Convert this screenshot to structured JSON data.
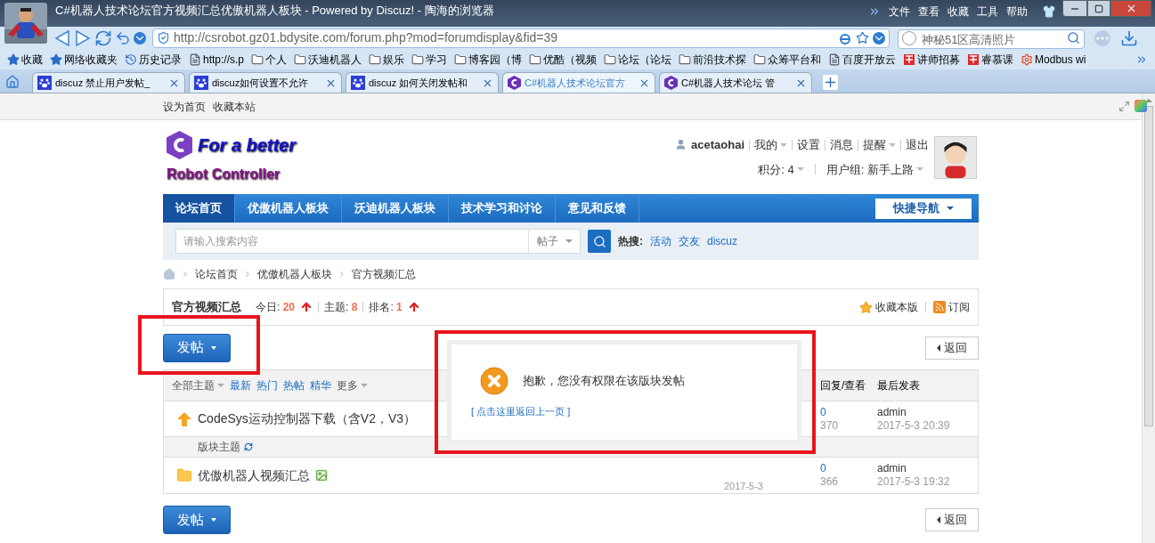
{
  "browser": {
    "title": "C#机器人技术论坛官方视频汇总优傲机器人板块 - Powered by Discuz! - 陶海的浏览器",
    "menu": [
      "文件",
      "查看",
      "收藏",
      "工具",
      "帮助"
    ],
    "address": "http://csrobot.gz01.bdysite.com/forum.php?mod=forumdisplay&fid=39",
    "search_placeholder": "神秘51区高清照片",
    "bookmarks": [
      {
        "label": "收藏",
        "kind": "fav"
      },
      {
        "label": "网络收藏夹",
        "kind": "star"
      },
      {
        "label": "历史记录",
        "kind": "history"
      },
      {
        "label": "http://s.p",
        "kind": "page"
      },
      {
        "label": "个人",
        "kind": "folder"
      },
      {
        "label": "沃迪机器人",
        "kind": "folder"
      },
      {
        "label": "娱乐",
        "kind": "folder"
      },
      {
        "label": "学习",
        "kind": "folder"
      },
      {
        "label": "博客园（博",
        "kind": "folder"
      },
      {
        "label": "优酷（视频",
        "kind": "folder"
      },
      {
        "label": "论坛（论坛",
        "kind": "folder"
      },
      {
        "label": "前沿技术探",
        "kind": "folder"
      },
      {
        "label": "众筹平台和",
        "kind": "folder"
      },
      {
        "label": "百度开放云",
        "kind": "page"
      },
      {
        "label": "讲师招募",
        "kind": "seal"
      },
      {
        "label": "睿慕课",
        "kind": "seal"
      },
      {
        "label": "Modbus wi",
        "kind": "gear"
      }
    ],
    "tabs": [
      {
        "label": "discuz 禁止用户发帖_",
        "kind": "paw",
        "selected": false
      },
      {
        "label": "discuz如何设置不允许",
        "kind": "paw",
        "selected": false
      },
      {
        "label": "discuz 如何关闭发帖和",
        "kind": "paw",
        "selected": false
      },
      {
        "label": "C#机器人技术论坛官方",
        "kind": "hex",
        "selected": true
      },
      {
        "label": "C#机器人技术论坛 管",
        "kind": "hex",
        "selected": false
      }
    ]
  },
  "site": {
    "top_links": [
      "设为首页",
      "收藏本站"
    ],
    "logo": {
      "line1": "For a better",
      "line2": "Robot Controller"
    },
    "user": {
      "name": "acetaohai",
      "links": [
        {
          "label": "我的",
          "dropdown": true
        },
        {
          "label": "设置",
          "dropdown": false
        },
        {
          "label": "消息",
          "dropdown": false
        },
        {
          "label": "提醒",
          "dropdown": true
        },
        {
          "label": "退出",
          "dropdown": false
        }
      ],
      "credits": "积分: 4",
      "group": "用户组: 新手上路"
    },
    "nav": [
      {
        "label": "论坛首页",
        "selected": true
      },
      {
        "label": "优傲机器人板块",
        "selected": false
      },
      {
        "label": "沃迪机器人板块",
        "selected": false
      },
      {
        "label": "技术学习和讨论",
        "selected": false
      },
      {
        "label": "意见和反馈",
        "selected": false
      }
    ],
    "quick_nav": "快捷导航",
    "search": {
      "placeholder": "请输入搜索内容",
      "type": "帖子",
      "hot_label": "热搜:",
      "hot": [
        "活动",
        "交友",
        "discuz"
      ]
    },
    "breadcrumb": [
      "论坛首页",
      "优傲机器人板块",
      "官方视频汇总"
    ],
    "forum": {
      "name": "官方视频汇总",
      "stats": [
        {
          "label": "今日:",
          "value": "20",
          "arrow": true
        },
        {
          "label": "主题:",
          "value": "8",
          "arrow": false
        },
        {
          "label": "排名:",
          "value": "1",
          "arrow": true
        }
      ],
      "actions": [
        {
          "label": "收藏本版",
          "kind": "star"
        },
        {
          "label": "订阅",
          "kind": "rss"
        }
      ]
    },
    "post_button": "发帖",
    "post_highlighted": true,
    "back": "返回",
    "filters": [
      {
        "label": "全部主题",
        "link": false,
        "dropdown": true
      },
      {
        "label": "最新",
        "link": true,
        "dropdown": false
      },
      {
        "label": "热门",
        "link": true,
        "dropdown": false
      },
      {
        "label": "热帖",
        "link": true,
        "dropdown": false
      },
      {
        "label": "精华",
        "link": true,
        "dropdown": false
      },
      {
        "label": "更多",
        "link": false,
        "dropdown": true
      }
    ],
    "columns": [
      "回复/查看",
      "最后发表"
    ],
    "rows": [
      {
        "kind": "pinned",
        "title": "CodeSys运动控制器下载（含V2，V3）",
        "replies": "0",
        "views": "370",
        "last_user": "admin",
        "last_time": "2017-5-3 20:39"
      },
      {
        "kind": "section",
        "title": "版块主题"
      },
      {
        "kind": "thread",
        "title": "优傲机器人视频汇总",
        "has_image": true,
        "author_date": "2017-5-3",
        "replies": "0",
        "views": "366",
        "last_user": "admin",
        "last_time": "2017-5-3 19:32"
      }
    ],
    "dialog": {
      "message": "抱歉，您没有权限在该版块发帖",
      "link": "[ 点击这里返回上一页 ]",
      "highlighted": true
    },
    "footer": {
      "post_button": "发帖",
      "back": "返回"
    }
  }
}
